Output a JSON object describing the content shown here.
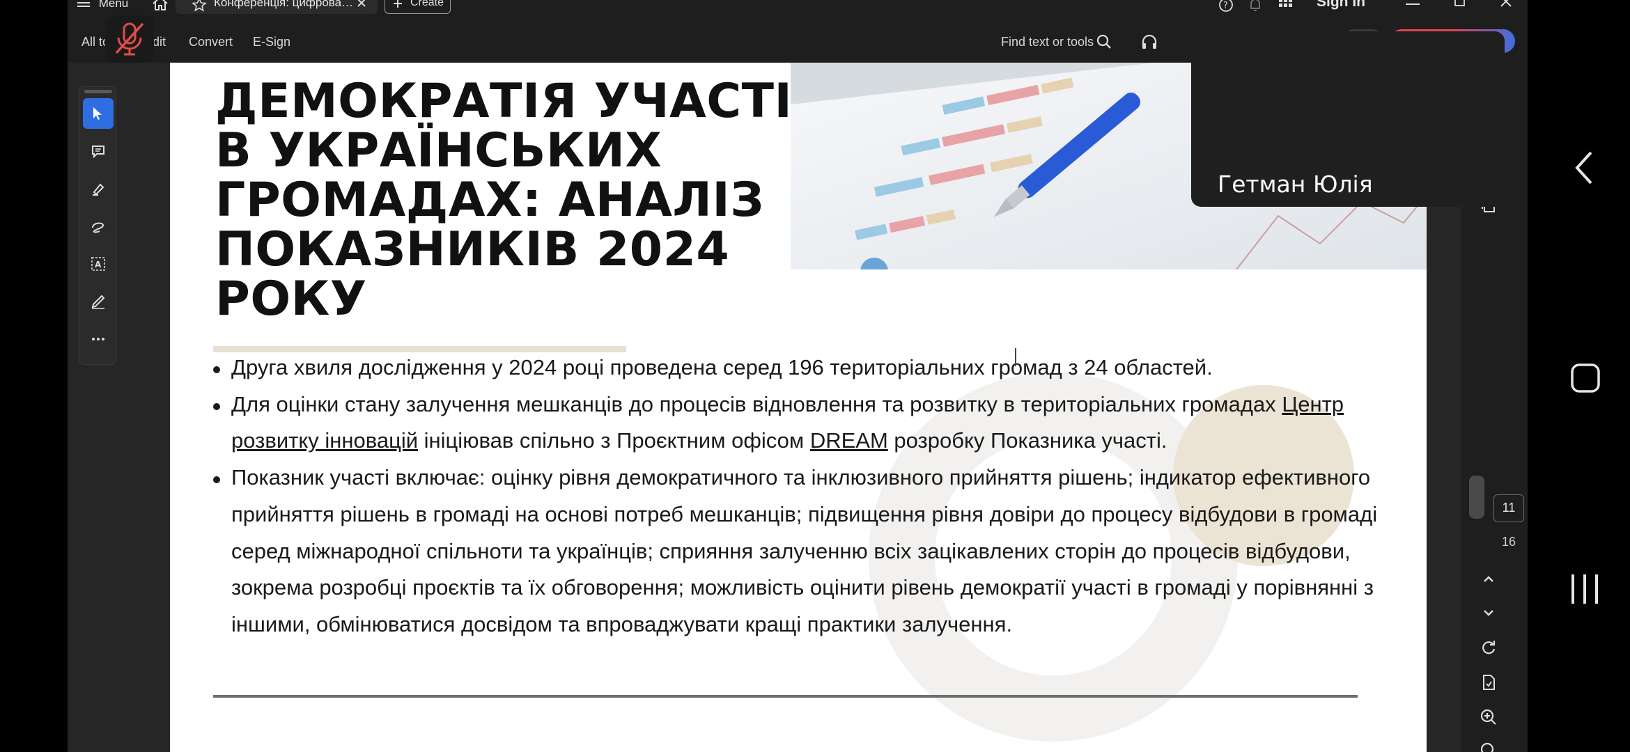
{
  "titlebar": {
    "menu_label": "Menu",
    "tab_title": "Конференція: цифрова…",
    "create_label": "Create",
    "sign_in_label": "Sign In"
  },
  "toolbar": {
    "all_tools_label": "All to",
    "edit_label": "dit",
    "convert_label": "Convert",
    "esign_label": "E-Sign",
    "find_placeholder": "Find text or tools"
  },
  "document": {
    "title": "ДЕМОКРАТІЯ УЧАСТІ В УКРАЇНСЬКИХ ГРОМАДАХ: АНАЛІЗ ПОКАЗНИКІВ 2024 РОКУ",
    "bullets": [
      {
        "text": "Друга хвиля дослідження у 2024 році проведена серед 196 територіальних громад з 24 областей."
      },
      {
        "before": "Для оцінки стану залучення мешканців до процесів відновлення та розвитку в територіальних громадах ",
        "link1": "Центр розвитку інновацій",
        "middle": " ініціював спільно з Проєктним офісом ",
        "link2": "DREAM",
        "after": " розробку Показника участі."
      },
      {
        "text": "Показник участі включає: оцінку рівня демократичного та інклюзивного прийняття рішень; індикатор ефективного прийняття рішень в громаді на основі потреб мешканців; підвищення рівня довіри до процесу відбудови в громаді серед міжнародної спільноти та українців; сприяння залученню всіх зацікавлених сторін до процесів відбудови, зокрема розробці проєктів та їх обговорення; можливість оцінити рівень демократії участі в громаді у порівнянні з іншими, обмінюватися досвідом та впроваджувати кращі практики залучення."
      }
    ]
  },
  "participant": {
    "name": "Гетман Юлія"
  },
  "page_nav": {
    "current_page": "11",
    "total_pages": "16"
  },
  "colors": {
    "frame_bg": "#1e1e1e",
    "page_bg": "#ffffff",
    "accent_blue": "#2f6ee2",
    "muted_red": "#e14b4b",
    "deco_beige": "#e9e3d4"
  }
}
